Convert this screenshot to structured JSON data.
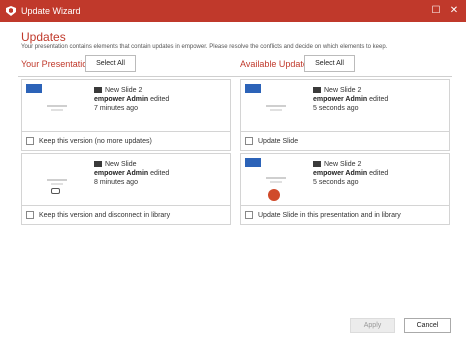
{
  "window": {
    "title": "Update Wizard",
    "minimize_glyph": "☐",
    "close_glyph": "✕",
    "accent_color": "#c0392b"
  },
  "header": {
    "title": "Updates",
    "description": "Your presentation contains elements that contain updates in empower. Please resolve the conflicts and decide on which elements to keep."
  },
  "left_section": {
    "label": "Your Presentation",
    "select_all": "Select All"
  },
  "right_section": {
    "label": "Available Updates",
    "select_all": "Select All"
  },
  "cards": [
    {
      "slide_name": "New Slide 2",
      "user": "empower Admin",
      "action": "edited",
      "time": "7 minutes ago",
      "thumb_title": "New Slide",
      "checkbox_label": "Keep this version (no more updates)"
    },
    {
      "slide_name": "New Slide 2",
      "user": "empower Admin",
      "action": "edited",
      "time": "5 seconds ago",
      "thumb_title": "New Slide",
      "checkbox_label": "Update Slide"
    },
    {
      "slide_name": "New Slide",
      "user": "empower Admin",
      "action": "edited",
      "time": "8 minutes ago",
      "thumb_title": "New Slide",
      "checkbox_label": "Keep this version and disconnect in library"
    },
    {
      "slide_name": "New Slide 2",
      "user": "empower Admin",
      "action": "edited",
      "time": "5 seconds ago",
      "thumb_title": "New Slide",
      "checkbox_label": "Update Slide in this presentation and in library"
    }
  ],
  "footer": {
    "apply": "Apply",
    "cancel": "Cancel"
  }
}
